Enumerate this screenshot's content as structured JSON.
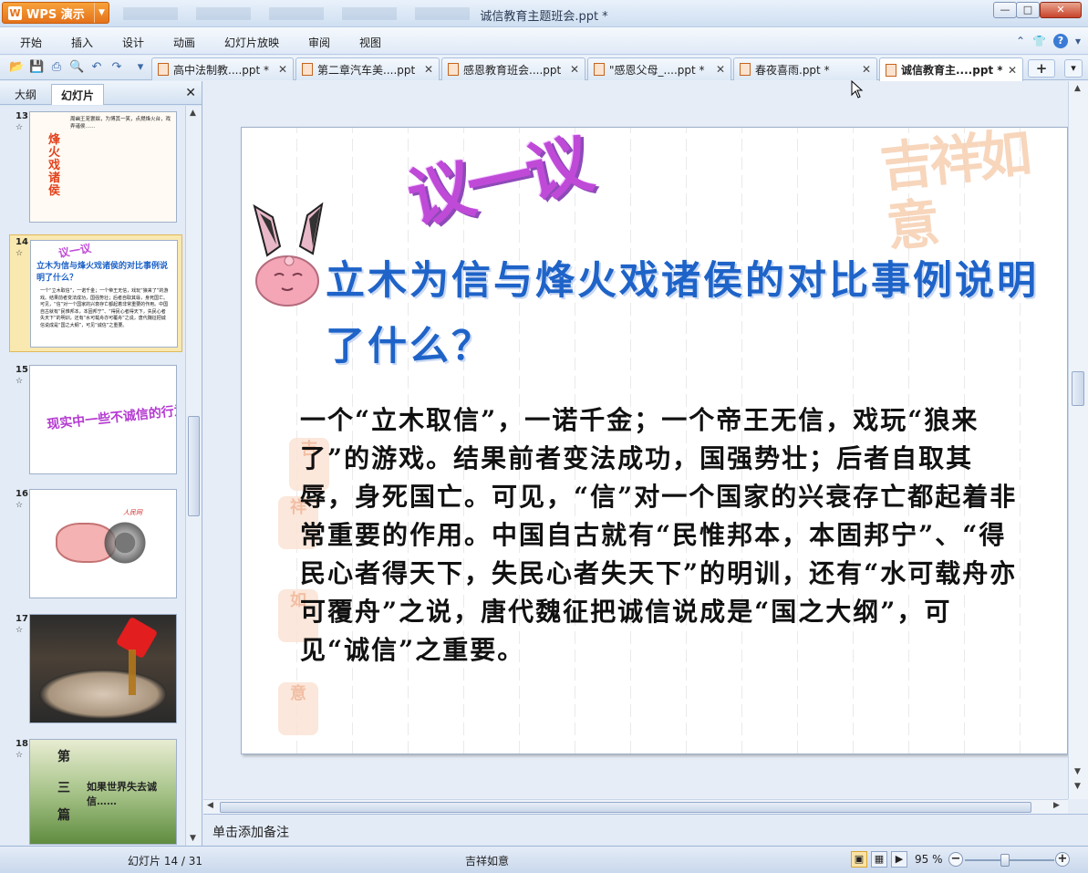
{
  "app": {
    "name": "WPS 演示",
    "logo_text": "W",
    "window_title": "诚信教育主题班会.ppt *"
  },
  "menu": [
    "开始",
    "插入",
    "设计",
    "动画",
    "幻灯片放映",
    "审阅",
    "视图"
  ],
  "doc_tabs": [
    {
      "label": "高中法制教....ppt *",
      "active": false
    },
    {
      "label": "第二章汽车美....ppt *",
      "active": false
    },
    {
      "label": "感恩教育班会....ppt *",
      "active": false
    },
    {
      "label": "\"感恩父母_....ppt *",
      "active": false
    },
    {
      "label": "春夜喜雨.ppt *",
      "active": false
    },
    {
      "label": "诚信教育主....ppt *",
      "active": true
    }
  ],
  "left_panel": {
    "tabs": [
      "大纲",
      "幻灯片"
    ],
    "active_tab": "幻灯片",
    "thumbnails": [
      {
        "num": "13",
        "title": "烽火戏诸侯",
        "text": "周幽王宠褒姒，为博其一笑，点燃烽火台，戏弄诸侯……"
      },
      {
        "num": "14",
        "heading": "议一议",
        "question": "立木为信与烽火戏诸侯的对比事例说明了什么？",
        "selected": true
      },
      {
        "num": "15",
        "title": "现实中一些不诚信的行为"
      },
      {
        "num": "16",
        "title": "人民网"
      },
      {
        "num": "17",
        "title": ""
      },
      {
        "num": "18",
        "label1": "第",
        "label2": "三",
        "label3": "篇",
        "text": "如果世界失去诚信……"
      }
    ]
  },
  "slide": {
    "heading": "议一议",
    "question": "立木为信与烽火戏诸侯的对比事例说明了什么？",
    "body": "一个“立木取信”，一诺千金；一个帝王无信，戏玩“狼来了”的游戏。结果前者变法成功，国强势壮；后者自取其辱，身死国亡。可见，“信”对一个国家的兴衰存亡都起着非常重要的作用。中国自古就有“民惟邦本，本固邦宁”、“得民心者得天下，失民心者失天下”的明训，还有“水可载舟亦可覆舟”之说，唐代魏征把诚信说成是“国之大纲”，可见“诚信”之重要。",
    "stamp_text": "吉祥如意"
  },
  "notes_placeholder": "单击添加备注",
  "status": {
    "slide_counter": "幻灯片 14 / 31",
    "theme": "吉祥如意",
    "zoom": "95 %"
  },
  "colors": {
    "heading": "#c04ad8",
    "question": "#1e63c8",
    "accent": "#e5721b"
  }
}
